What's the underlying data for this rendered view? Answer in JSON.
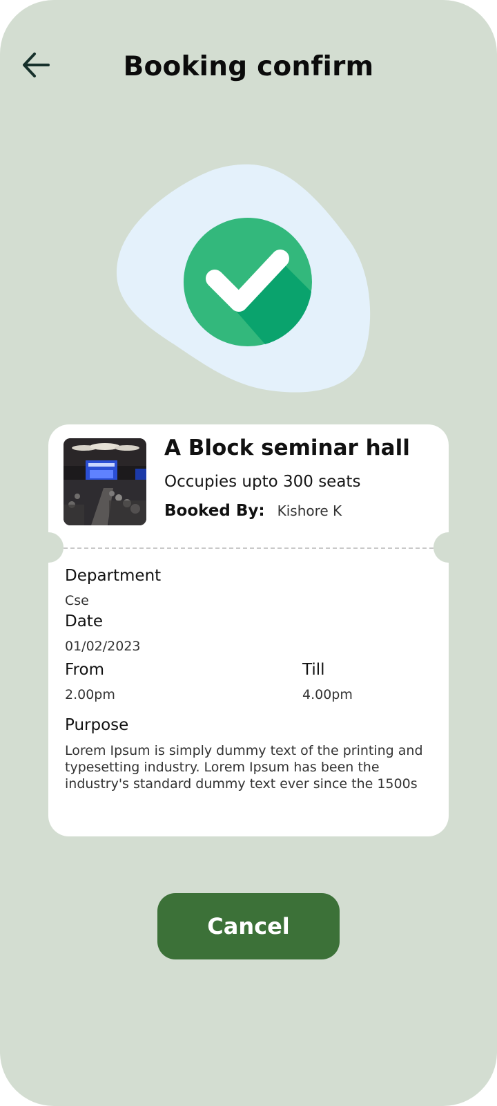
{
  "header": {
    "title": "Booking confirm",
    "back_icon": "arrow-left-icon"
  },
  "status": {
    "icon": "check-circle-icon",
    "colors": {
      "blob": "#e4f1fb",
      "circle": "#33b87c",
      "shadow": "#0aa36d"
    }
  },
  "booking": {
    "hall_name": "A Block seminar hall",
    "capacity": "Occupies upto 300 seats",
    "booked_by_label": "Booked By:",
    "booked_by_value": "Kishore K",
    "department_label": "Department",
    "department_value": "Cse",
    "date_label": "Date",
    "date_value": "01/02/2023",
    "from_label": "From",
    "from_value": "2.00pm",
    "till_label": "Till",
    "till_value": "4.00pm",
    "purpose_label": "Purpose",
    "purpose_value": "Lorem Ipsum is simply dummy text of the printing and typesetting industry. Lorem Ipsum has been the industry's standard dummy text ever since the 1500s"
  },
  "actions": {
    "cancel_label": "Cancel"
  },
  "theme": {
    "background": "#d3ddd1",
    "card": "#ffffff",
    "button": "#3c7138"
  }
}
